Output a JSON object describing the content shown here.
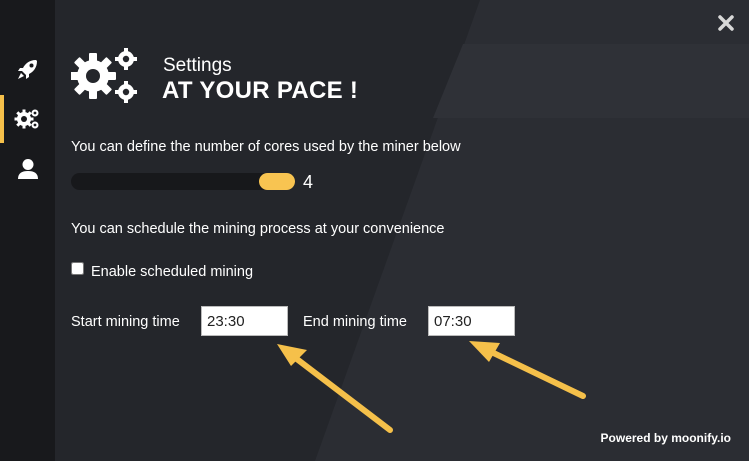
{
  "sidebar": {
    "items": [
      {
        "icon": "rocket-icon",
        "active": false
      },
      {
        "icon": "gears-icon",
        "active": true
      },
      {
        "icon": "user-icon",
        "active": false
      }
    ]
  },
  "window": {
    "close_icon": "close-icon"
  },
  "header": {
    "icon": "gears-icon",
    "title": "Settings",
    "subtitle": "AT YOUR PACE !"
  },
  "cores": {
    "description": "You can define the number of cores used by the miner below",
    "value": "4"
  },
  "schedule": {
    "description": "You can schedule the mining process at your convenience",
    "checkbox_label": "Enable scheduled mining",
    "checked": false,
    "start_label": "Start mining time",
    "start_value": "23:30",
    "end_label": "End mining time",
    "end_value": "07:30"
  },
  "footer": {
    "powered_by": "Powered by moonify.io"
  },
  "colors": {
    "accent": "#f8c451",
    "sidebar_bg": "#18191c",
    "main_bg": "#24262b",
    "arrow": "#f5c04a"
  }
}
